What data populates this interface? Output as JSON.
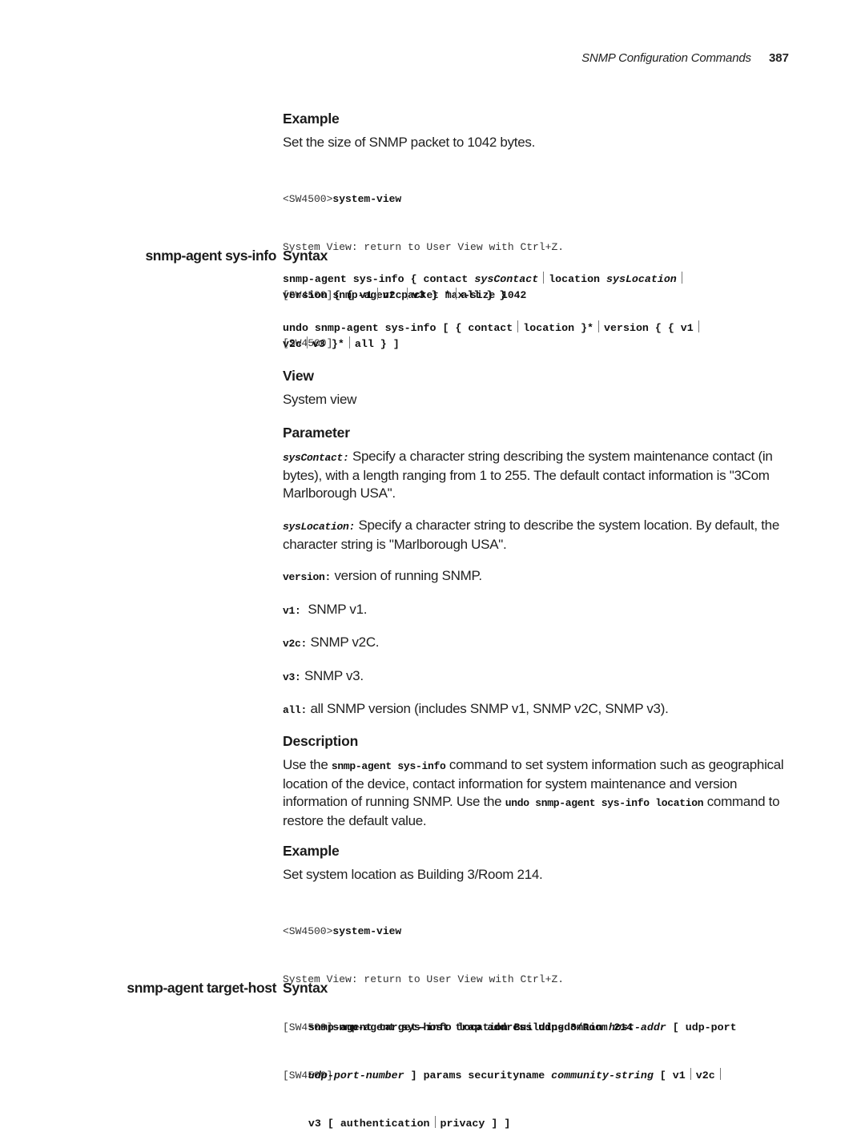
{
  "running_head": {
    "title": "SNMP Configuration Commands",
    "page_number": "387"
  },
  "example1": {
    "heading": "Example",
    "intro": "Set the size of SNMP packet to 1042 bytes.",
    "code": [
      {
        "prompt": "<SW4500>",
        "command": "system-view"
      },
      {
        "prompt": "System View: return to User View with Ctrl+Z.",
        "command": ""
      },
      {
        "prompt": "[SW4500]",
        "command": "snmp-agent packet max-size 1042"
      },
      {
        "prompt": "[SW4500]",
        "command": ""
      }
    ]
  },
  "sysinfo": {
    "command_name": "snmp-agent sys-info",
    "syntax_heading": "Syntax",
    "syntax1": {
      "l1_a": "snmp-agent sys-info { contact ",
      "l1_b": "sysContact",
      "l1_c": "location ",
      "l1_d": "sysLocation",
      "l2_a": "version { { v1",
      "l2_b": "v2c",
      "l2_c": "v3 } *",
      "l2_d": "all } }"
    },
    "syntax2": {
      "l1_a": "undo snmp-agent sys-info [ { contact",
      "l1_b": "location }*",
      "l1_c": "version { { v1",
      "l2_a": "v2c",
      "l2_b": "v3 }*",
      "l2_c": "all } ]"
    },
    "view_heading": "View",
    "view_text": "System view",
    "parameter_heading": "Parameter",
    "parameters": [
      {
        "name": "sysContact:",
        "text": " Specify a character string describing the system maintenance contact (in bytes), with a length ranging from 1 to 255. The default contact information is \"3Com Marlborough USA\"."
      },
      {
        "name": "sysLocation:",
        "text": " Specify a character string to describe the system location. By default, the character string is \"Marlborough USA\"."
      },
      {
        "name": "version:",
        "text": " version of running SNMP."
      },
      {
        "name": "v1:",
        "text": "  SNMP v1."
      },
      {
        "name": "v2c:",
        "text": " SNMP v2C."
      },
      {
        "name": "v3:",
        "text": " SNMP v3."
      },
      {
        "name": "all:",
        "text": " all SNMP version (includes SNMP v1, SNMP v2C, SNMP v3)."
      }
    ],
    "description_heading": "Description",
    "description": {
      "t1": "Use the ",
      "c1": "snmp-agent sys-info",
      "t2": " command to set system information such as geographical location of the device, contact information for system maintenance and version information of running SNMP. Use the ",
      "c2": "undo snmp-agent sys-info location",
      "t3": " command to restore the default value."
    },
    "example_heading": "Example",
    "example_intro": "Set system location as Building 3/Room 214.",
    "example_code": [
      {
        "prompt": "<SW4500>",
        "command": "system-view"
      },
      {
        "prompt": "System View: return to User View with Ctrl+Z.",
        "command": ""
      },
      {
        "prompt": "[SW4500]",
        "command": "snmp-agent sys-info location Building 3/Room 214"
      },
      {
        "prompt": "[SW4500]",
        "command": ""
      }
    ]
  },
  "targethost": {
    "command_name": "snmp-agent target-host",
    "syntax_heading": "Syntax",
    "syntax": {
      "l1_a": "snmp-agent target-host trap address udp-domain ",
      "l1_b": "host-addr",
      "l1_c": " [ udp-port",
      "l2_a": "udp-port-number",
      "l2_b": " ] params securityname ",
      "l2_c": "community-string",
      "l2_d": " [ v1",
      "l2_e": "v2c",
      "l3_a": "v3 [ authentication",
      "l3_b": "privacy ] ]"
    }
  }
}
